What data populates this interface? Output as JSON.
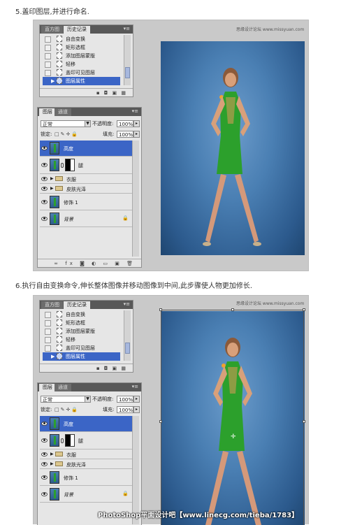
{
  "step1": {
    "text": "5.盖印图层,并进行命名."
  },
  "step2": {
    "text": "6.执行自由变换命令,伸长整体图像并移动图像到中间,此步骤使人物更加修长."
  },
  "history": {
    "tabs": [
      "直方图",
      "历史记录"
    ],
    "items": [
      "自由变换",
      "矩形选框",
      "添加图层蒙版",
      "轻移",
      "盖印可见图层",
      "图层属性"
    ],
    "selected_index": 5
  },
  "layers": {
    "tabs": [
      "图层",
      "通道"
    ],
    "blend_mode": "正常",
    "opacity_label": "不透明度:",
    "opacity_value": "100%",
    "lock_label": "锁定:",
    "fill_label": "填充:",
    "fill_value": "100%",
    "items": [
      {
        "name": "高度",
        "type": "layer",
        "selected": true
      },
      {
        "name": "腿",
        "type": "masked"
      },
      {
        "name": "衣服",
        "type": "group"
      },
      {
        "name": "皮肤光泽",
        "type": "group"
      },
      {
        "name": "修饰 1",
        "type": "layer"
      },
      {
        "name": "背景",
        "type": "background"
      }
    ]
  },
  "photo": {
    "watermark": "思缘设计论坛 www.missyuan.com"
  },
  "footer_watermark": "PhotoShop平面设计吧【www.linecg.com/tieba/1783】",
  "colors": {
    "selection": "#3b65c6",
    "dress": "#2ca02c",
    "background": "#4a7fb3"
  }
}
